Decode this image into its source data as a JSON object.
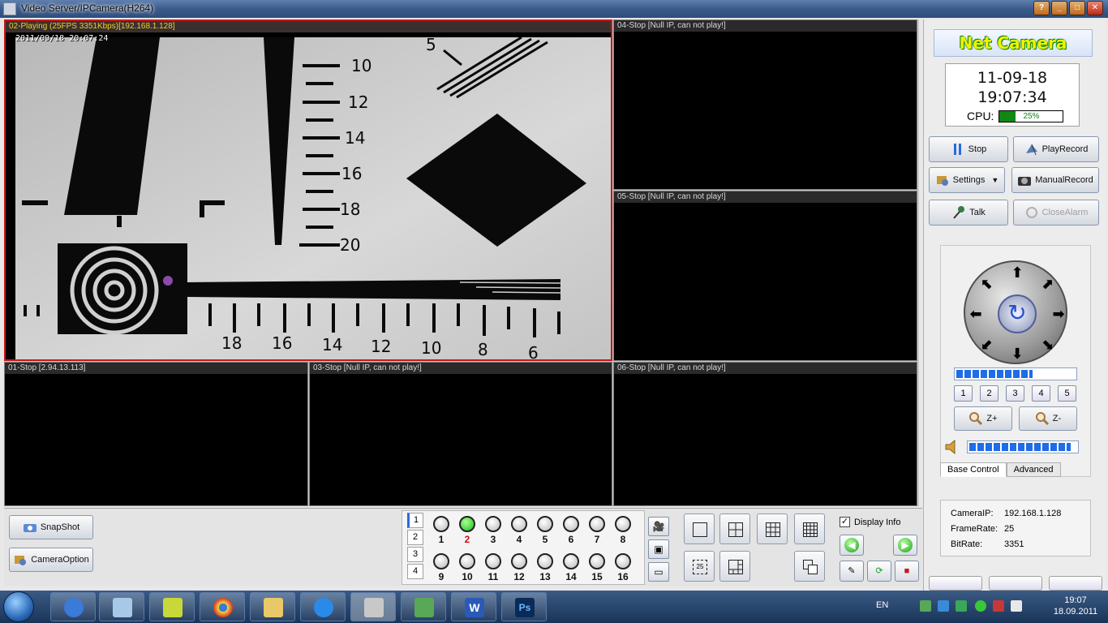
{
  "window": {
    "title": "Video Server/IPCamera(H264)",
    "buttons": {
      "help": "?",
      "minimize": "_",
      "maximize": "□",
      "close": "✕"
    }
  },
  "panes": [
    {
      "id": "02",
      "caption": "02-Playing (25FPS 3351Kbps)[192.168.1.128]",
      "timestamp": "2011/09/18 20:07:24",
      "active": true
    },
    {
      "id": "04",
      "caption": "04-Stop [Null IP, can not play!]"
    },
    {
      "id": "05",
      "caption": "05-Stop [Null IP, can not play!]"
    },
    {
      "id": "01",
      "caption": "01-Stop [2.94.13.113]"
    },
    {
      "id": "03",
      "caption": "03-Stop [Null IP, can not play!]"
    },
    {
      "id": "06",
      "caption": "06-Stop [Null IP, can not play!]"
    }
  ],
  "feed_marks": {
    "right_scale": [
      "10",
      "12",
      "14",
      "16",
      "18",
      "20"
    ],
    "bottom_scale": [
      "18",
      "16",
      "14",
      "12",
      "10",
      "8",
      "6"
    ],
    "top_mark": "5"
  },
  "right": {
    "logo": "Net Camera",
    "date": "11-09-18",
    "time": "19:07:34",
    "cpu_label": "CPU:",
    "cpu_text": "25%",
    "cpu_percent": 25,
    "buttons": {
      "stop": "Stop",
      "playrecord": "PlayRecord",
      "settings": "Settings",
      "manualrecord": "ManualRecord",
      "talk": "Talk",
      "closealarm": "CloseAlarm"
    },
    "speed_percent": 65,
    "volume_percent": 95,
    "presets": [
      "1",
      "2",
      "3",
      "4",
      "5"
    ],
    "zoom_in": "Z+",
    "zoom_out": "Z-",
    "tabs": [
      "Base Control",
      "Advanced"
    ],
    "info": {
      "camera_ip_label": "CameraIP:",
      "camera_ip": "192.168.1.128",
      "framerate_label": "FrameRate:",
      "framerate": "25",
      "bitrate_label": "BitRate:",
      "bitrate": "3351"
    }
  },
  "bottom": {
    "snapshot": "SnapShot",
    "cameraoption": "CameraOption",
    "pages": [
      "1",
      "2",
      "3",
      "4"
    ],
    "channels_row1": [
      "1",
      "2",
      "3",
      "4",
      "5",
      "6",
      "7",
      "8"
    ],
    "channels_row2": [
      "9",
      "10",
      "11",
      "12",
      "13",
      "14",
      "15",
      "16"
    ],
    "active_channel": "2",
    "display_info_label": "Display Info",
    "display_info_checked": true,
    "layout_25_label": "25"
  },
  "taskbar": {
    "lang": "EN",
    "time": "19:07",
    "date": "18.09.2011",
    "word_label": "W",
    "ps_label": "Ps"
  }
}
